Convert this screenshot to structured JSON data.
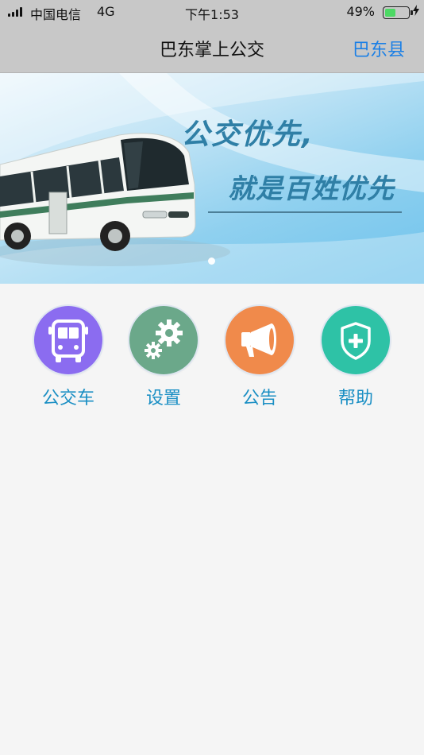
{
  "status_bar": {
    "carrier": "中国电信",
    "network": "4G",
    "time": "下午1:53",
    "battery_percent": "49%",
    "battery_level": 0.49,
    "battery_color": "#4cd964"
  },
  "nav": {
    "title": "巴东掌上公交",
    "region": "巴东县",
    "region_color": "#1a7fe6"
  },
  "banner": {
    "slogan_line1": "公交优先,",
    "slogan_line2": "就是百姓优先",
    "page_count": 1,
    "active_page": 1
  },
  "menu": {
    "items": [
      {
        "label": "公交车",
        "icon": "bus-icon",
        "color": "#8b6cf0"
      },
      {
        "label": "设置",
        "icon": "gears-icon",
        "color": "#6ba88a"
      },
      {
        "label": "公告",
        "icon": "megaphone-icon",
        "color": "#f08a4b"
      },
      {
        "label": "帮助",
        "icon": "shield-plus-icon",
        "color": "#2ec2a6"
      }
    ]
  }
}
